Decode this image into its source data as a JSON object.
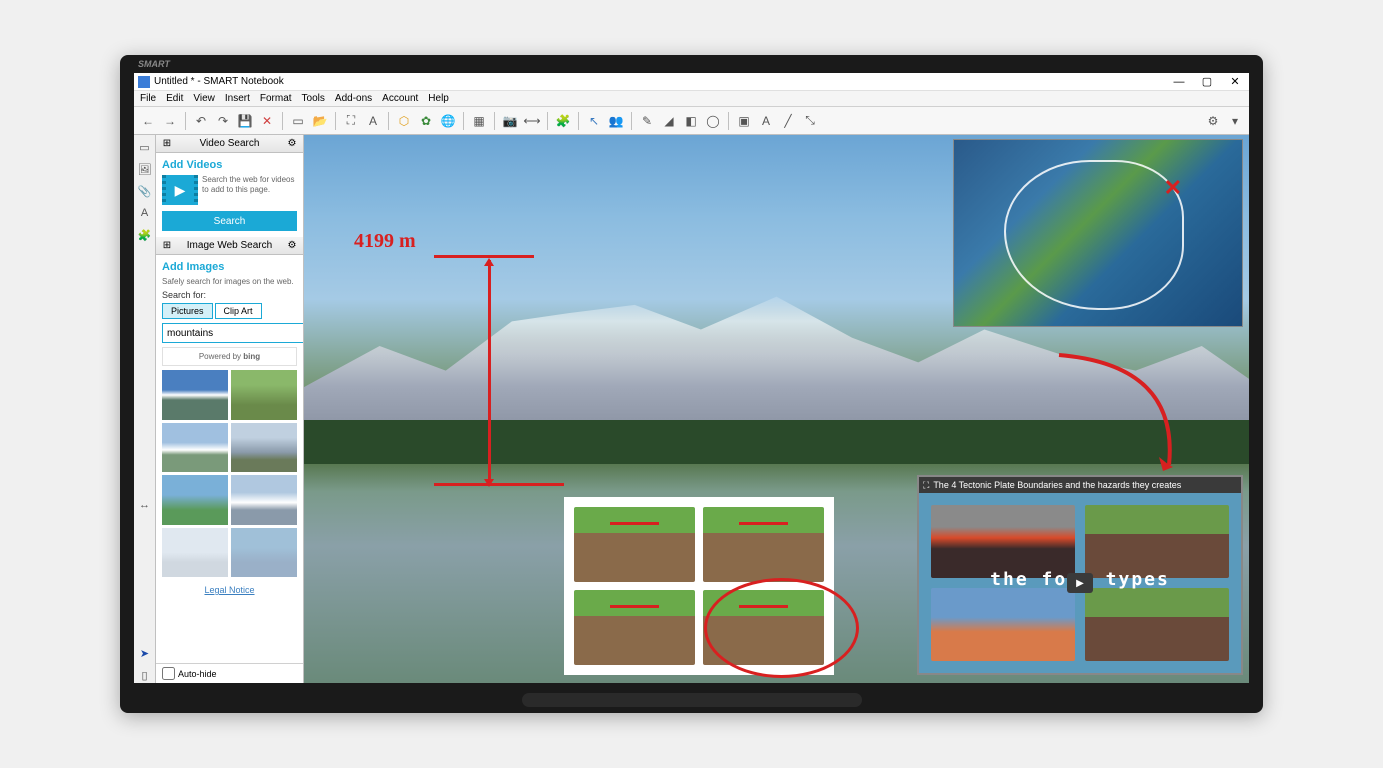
{
  "brand": "SMART",
  "window": {
    "title": "Untitled * - SMART Notebook"
  },
  "menus": [
    "File",
    "Edit",
    "View",
    "Insert",
    "Format",
    "Tools",
    "Add-ons",
    "Account",
    "Help"
  ],
  "sidebar": {
    "video_panel": {
      "title": "Video Search",
      "heading": "Add Videos",
      "description": "Search the web for videos to add to this page.",
      "search_button": "Search"
    },
    "image_panel": {
      "title": "Image Web Search",
      "heading": "Add Images",
      "subheading": "Safely search for images on the web.",
      "search_for_label": "Search for:",
      "tabs": [
        "Pictures",
        "Clip Art"
      ],
      "search_value": "mountains",
      "powered_by": "Powered by",
      "bing_label": "bing",
      "legal_notice": "Legal Notice"
    },
    "autohide_label": "Auto-hide"
  },
  "canvas": {
    "annotation_height": "4199 m",
    "map_mark": "✕",
    "video_title": "The 4 Tectonic Plate Boundaries and the hazards they creates",
    "video_overlay": "the four types"
  }
}
